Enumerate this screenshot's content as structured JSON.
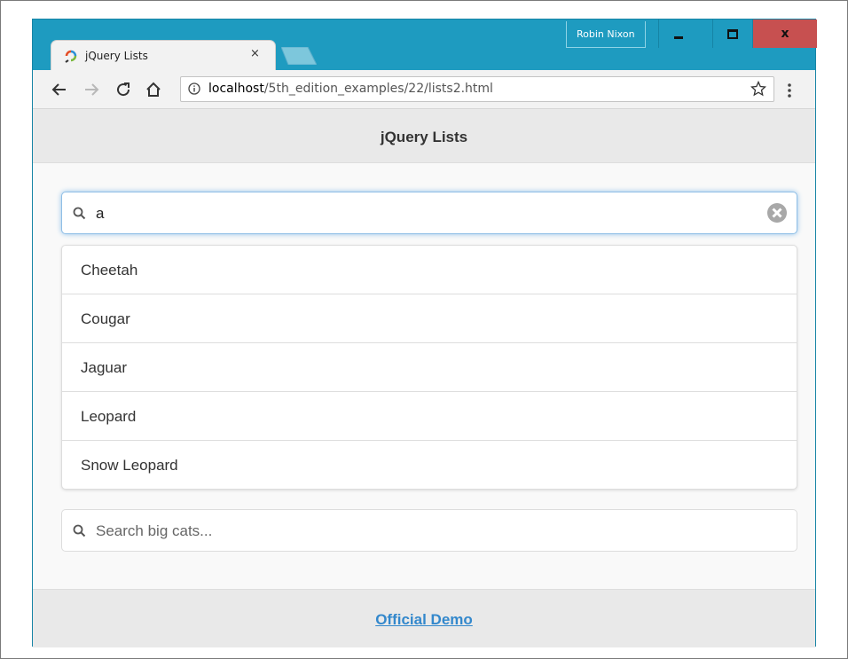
{
  "browser": {
    "tab_title": "jQuery Lists",
    "tab_close": "×",
    "profile_name": "Robin Nixon",
    "close_glyph": "x",
    "url_host": "localhost",
    "url_path": "/5th_edition_examples/22/lists2.html"
  },
  "page": {
    "header_title": "jQuery Lists",
    "filter_value": "a",
    "list_items": [
      "Cheetah",
      "Cougar",
      "Jaguar",
      "Leopard",
      "Snow Leopard"
    ],
    "search_placeholder": "Search big cats...",
    "footer_link": "Official Demo"
  },
  "colors": {
    "window_frame": "#1e9bc0",
    "close_button": "#c75050",
    "link": "#3388cc",
    "focus_glow": "#8fc1ea"
  },
  "icons": [
    "favicon-icon",
    "back-arrow-icon",
    "forward-arrow-icon",
    "reload-icon",
    "home-icon",
    "info-icon",
    "star-icon",
    "menu-icon",
    "search-icon",
    "clear-icon"
  ]
}
